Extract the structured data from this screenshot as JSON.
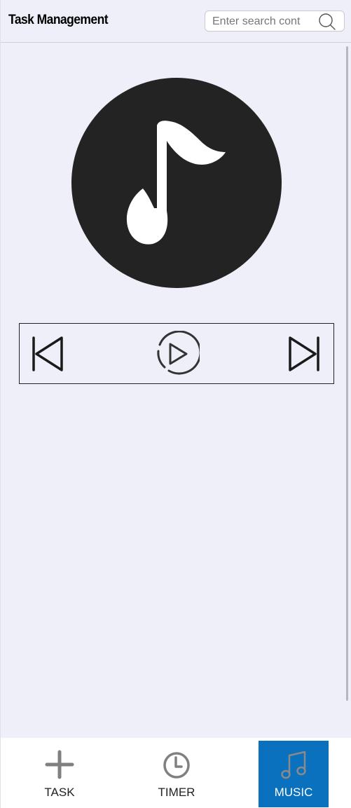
{
  "header": {
    "title": "Task Management",
    "search_placeholder": "Enter search cont"
  },
  "player": {
    "controls": [
      "previous",
      "play",
      "next"
    ]
  },
  "nav": {
    "items": [
      {
        "label": "TASK",
        "icon": "plus-icon",
        "active": false
      },
      {
        "label": "TIMER",
        "icon": "clock-icon",
        "active": false
      },
      {
        "label": "MUSIC",
        "icon": "music-note-icon",
        "active": true
      }
    ]
  },
  "colors": {
    "background": "#efeff9",
    "art_circle": "#232323",
    "accent": "#0a71bf",
    "nav_icon_inactive": "#808080"
  }
}
